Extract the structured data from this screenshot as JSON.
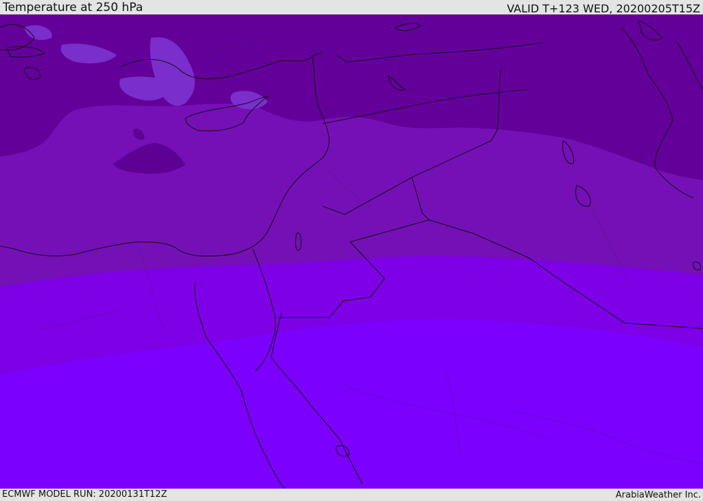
{
  "header": {
    "title": "Temperature at 250 hPa",
    "valid": "VALID T+123 WED, 20200205T15Z"
  },
  "footer": {
    "model_run": "ECMWF MODEL RUN: 20200131T12Z",
    "credit": "ArabiaWeather Inc."
  },
  "map": {
    "region": "Eastern Mediterranean and Middle East",
    "colors": {
      "coldest_band": "#63009a",
      "cold_band": "#7410b6",
      "mid_band": "#7d00e6",
      "warm_band": "#7c00fe",
      "light_patch": "#7a2ecc",
      "dark_patch": "#5e0094",
      "coastline": "#111111"
    }
  }
}
